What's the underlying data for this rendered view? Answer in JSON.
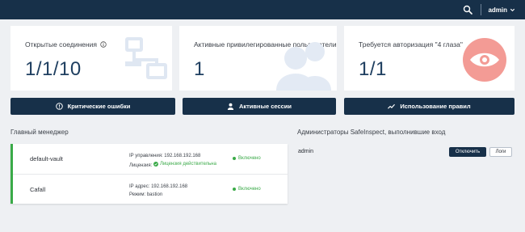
{
  "header": {
    "user_name": "admin",
    "icons": [
      "search-icon",
      "chevron-down-icon"
    ]
  },
  "stats": [
    {
      "label": "Открытые соединения",
      "value": "1/1/10",
      "icon": "network-icon"
    },
    {
      "label": "Активные привилегированные пользователи",
      "value": "1",
      "icon": "users-icon"
    },
    {
      "label": "Требуется авторизация \"4 глаза\"",
      "value": "1/1",
      "icon": "eye-icon"
    }
  ],
  "actions": [
    {
      "label": "Критические ошибки",
      "icon": "alert-icon"
    },
    {
      "label": "Активные сессии",
      "icon": "user-icon"
    },
    {
      "label": "Использование правил",
      "icon": "trend-icon"
    }
  ],
  "main_manager": {
    "title": "Главный менеджер",
    "rows": [
      {
        "name": "default-vault",
        "line1": "IP управления: 192.168.192.168",
        "line2_label": "Лицензия:",
        "line2_value": "Лицензия действительна",
        "status": "Включено"
      },
      {
        "name": "Cafall",
        "line1": "IP адрес: 192.168.192.168",
        "line2_label": "Режим:",
        "line2_value": "bastion",
        "status": "Включено"
      }
    ]
  },
  "admins": {
    "title": "Администраторы SafeInspect, выполнившие вход",
    "rows": [
      {
        "name": "admin",
        "disconnect_label": "Отключить",
        "logs_label": "Логи"
      }
    ]
  },
  "colors": {
    "topbar": "#173049",
    "accent_green": "#3aaa48",
    "value_blue": "#1f3f60",
    "eye_red": "#f39b95"
  }
}
